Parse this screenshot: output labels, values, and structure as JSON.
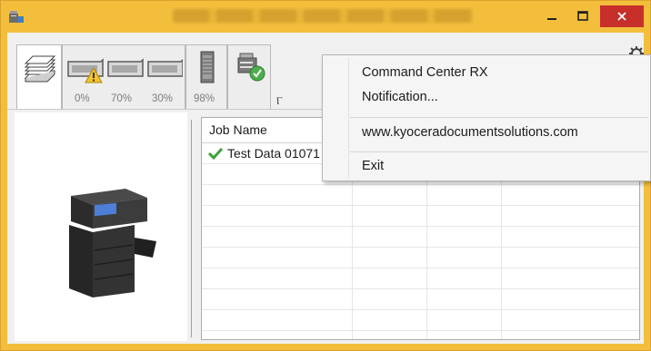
{
  "window": {
    "title": "",
    "controls": {
      "minimize": "minimize",
      "maximize": "maximize",
      "close": "close"
    }
  },
  "tabs": [
    {
      "id": "jobs",
      "icon": "paper-stack-icon"
    },
    {
      "id": "toner",
      "icon": "toner-cartridge-icon",
      "levels": [
        "0%",
        "70%",
        "30%"
      ],
      "warning_on_first": true
    },
    {
      "id": "waste",
      "icon": "waste-toner-icon",
      "level": "98%"
    },
    {
      "id": "device",
      "icon": "device-status-ok-icon"
    }
  ],
  "collapse_glyph": "Ⲅ",
  "job_list": {
    "columns": [
      "Job Name",
      "",
      "",
      ""
    ],
    "rows": [
      {
        "status": "check-icon",
        "name": "Test Data 01071"
      }
    ]
  },
  "context_menu": {
    "items": [
      "Command Center RX",
      "Notification...",
      "www.kyoceradocumentsolutions.com",
      "Exit"
    ]
  },
  "colors": {
    "frame": "#f3be3c",
    "close": "#c7302a",
    "check": "#3aa33a"
  }
}
